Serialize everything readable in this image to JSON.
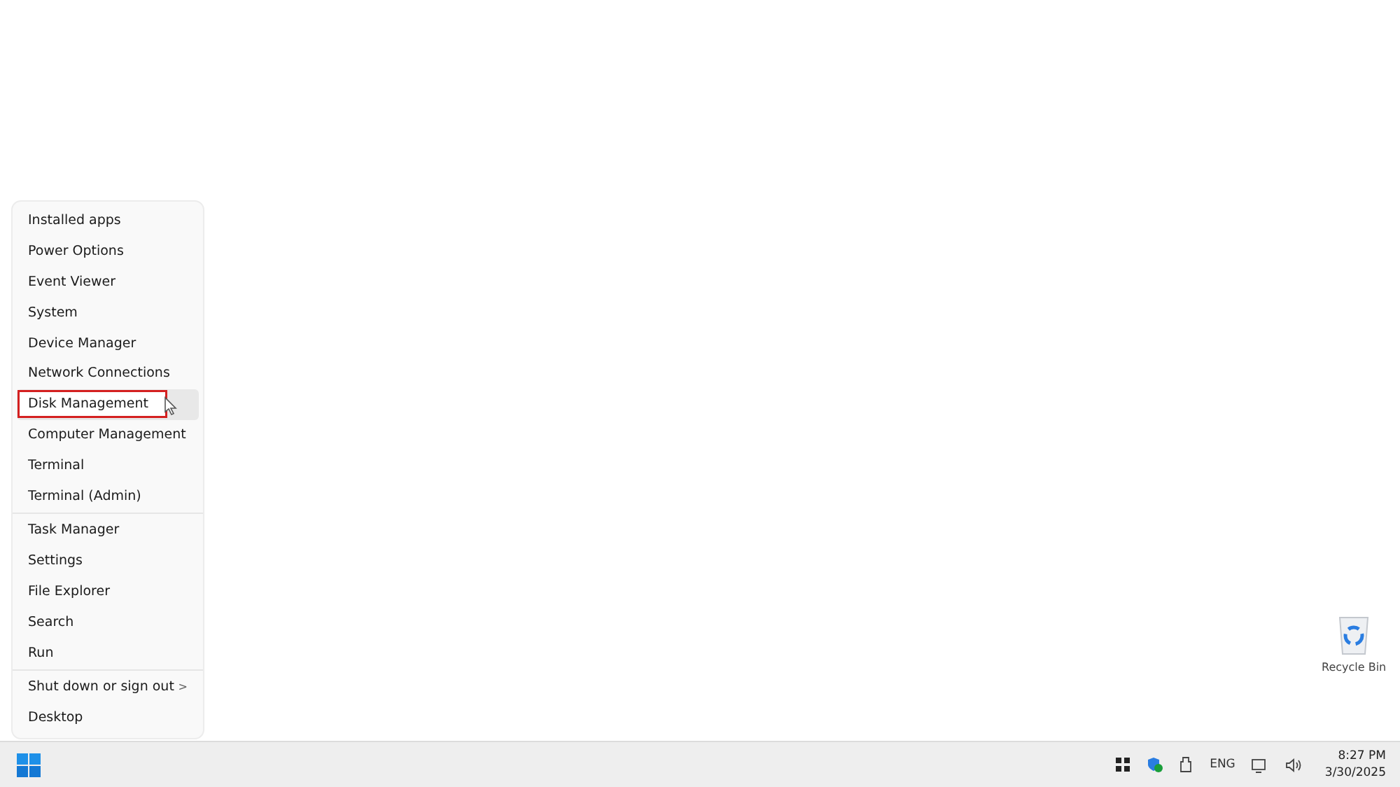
{
  "context_menu": {
    "groups": [
      {
        "items": [
          {
            "label": "Installed apps",
            "selected": false,
            "outlined": false,
            "submenu": false
          },
          {
            "label": "Power Options",
            "selected": false,
            "outlined": false,
            "submenu": false
          },
          {
            "label": "Event Viewer",
            "selected": false,
            "outlined": false,
            "submenu": false
          },
          {
            "label": "System",
            "selected": false,
            "outlined": false,
            "submenu": false
          },
          {
            "label": "Device Manager",
            "selected": false,
            "outlined": false,
            "submenu": false
          },
          {
            "label": "Network Connections",
            "selected": false,
            "outlined": false,
            "submenu": false
          },
          {
            "label": "Disk Management",
            "selected": true,
            "outlined": true,
            "submenu": false
          },
          {
            "label": "Computer Management",
            "selected": false,
            "outlined": false,
            "submenu": false
          },
          {
            "label": "Terminal",
            "selected": false,
            "outlined": false,
            "submenu": false
          },
          {
            "label": "Terminal (Admin)",
            "selected": false,
            "outlined": false,
            "submenu": false
          }
        ]
      },
      {
        "items": [
          {
            "label": "Task Manager",
            "selected": false,
            "outlined": false,
            "submenu": false
          },
          {
            "label": "Settings",
            "selected": false,
            "outlined": false,
            "submenu": false
          },
          {
            "label": "File Explorer",
            "selected": false,
            "outlined": false,
            "submenu": false
          },
          {
            "label": "Search",
            "selected": false,
            "outlined": false,
            "submenu": false
          },
          {
            "label": "Run",
            "selected": false,
            "outlined": false,
            "submenu": false
          }
        ]
      },
      {
        "items": [
          {
            "label": "Shut down or sign out",
            "selected": false,
            "outlined": false,
            "submenu": true,
            "arrow": ">"
          },
          {
            "label": "Desktop",
            "selected": false,
            "outlined": false,
            "submenu": false
          }
        ]
      }
    ]
  },
  "desktop_icons": [
    {
      "label": "Recycle Bin"
    }
  ],
  "taskbar": {
    "language": "ENG",
    "time": "8:27 PM",
    "date": "3/30/2025"
  }
}
